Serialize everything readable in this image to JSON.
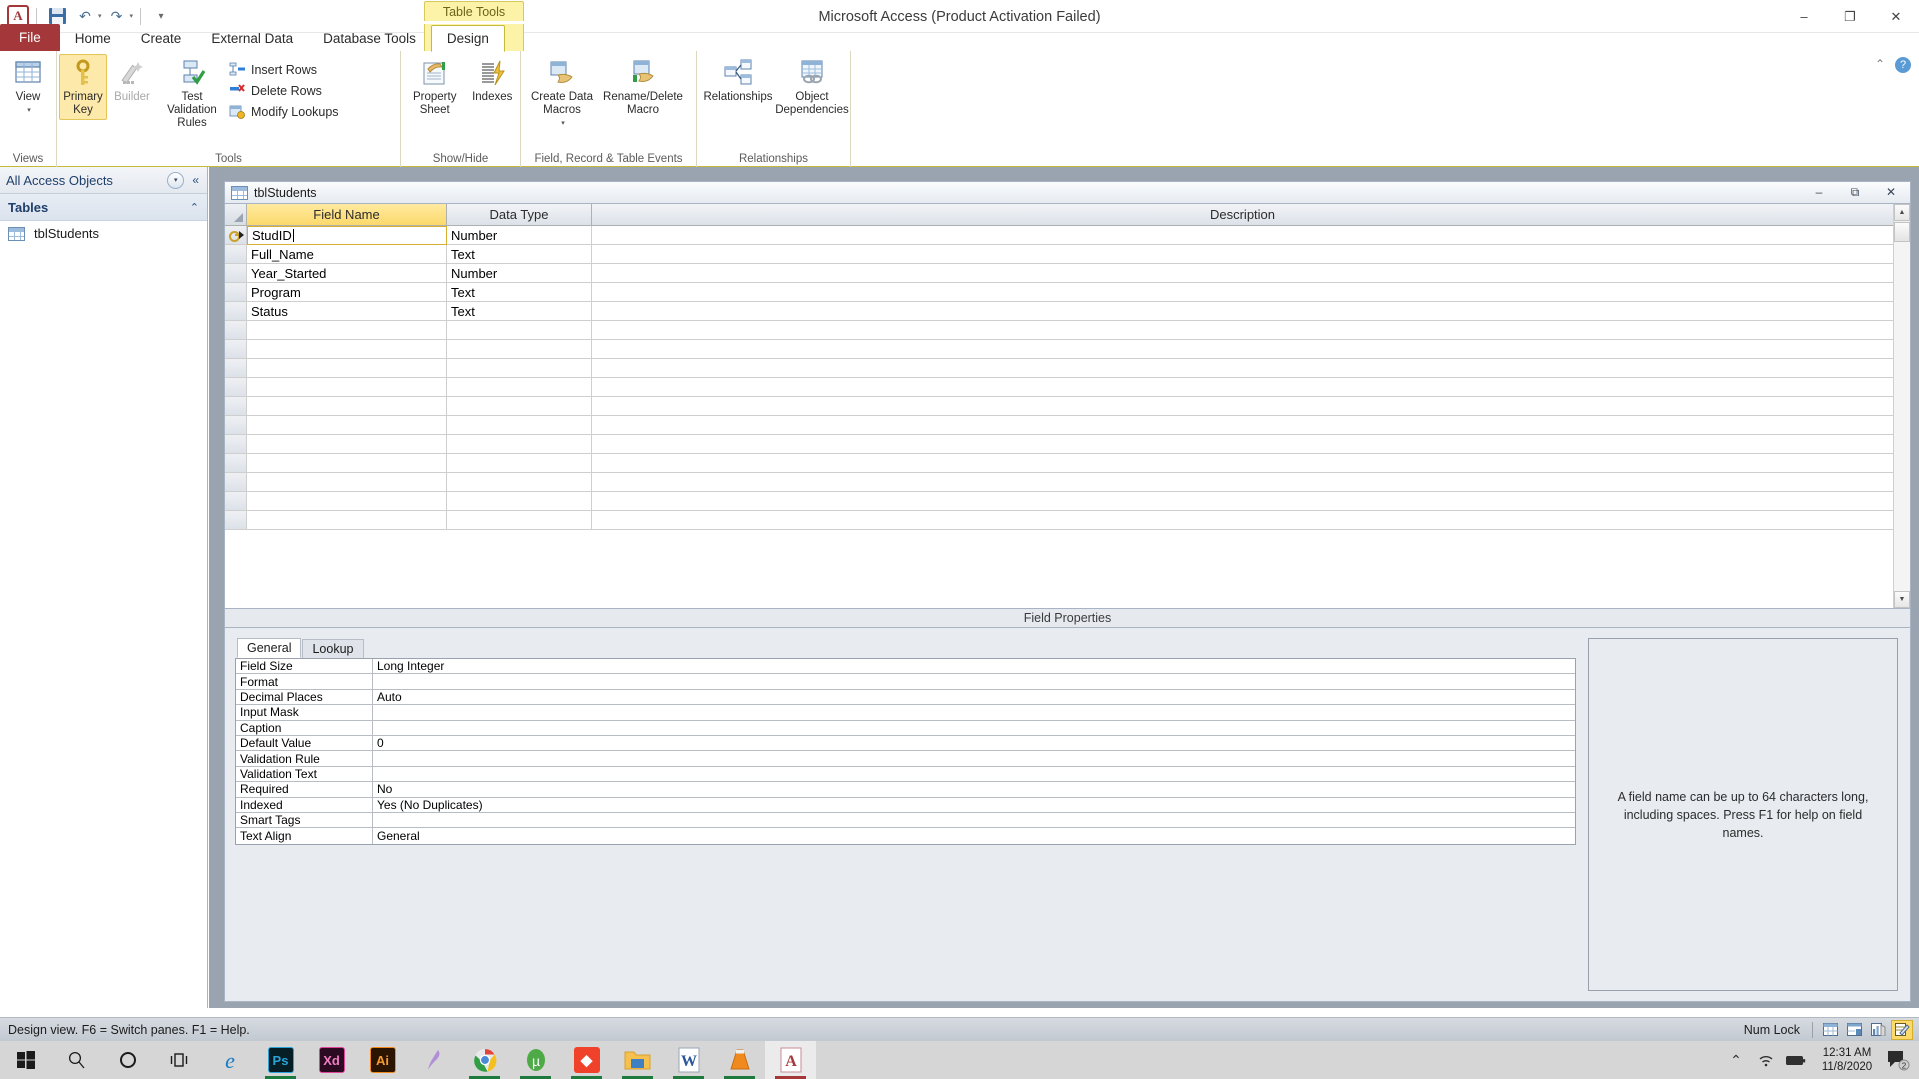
{
  "window": {
    "title": "Microsoft Access (Product Activation Failed)",
    "minimize": "–",
    "maximize": "❐",
    "close": "✕"
  },
  "quick_access": {
    "app_letter": "A",
    "save": "save-icon",
    "undo": "↶",
    "redo": "↷",
    "customize": "▾"
  },
  "ribbon": {
    "contextual_tab": "Table Tools",
    "tabs": [
      {
        "label": "File",
        "active": false
      },
      {
        "label": "Home",
        "active": false
      },
      {
        "label": "Create",
        "active": false
      },
      {
        "label": "External Data",
        "active": false
      },
      {
        "label": "Database Tools",
        "active": false
      },
      {
        "label": "Design",
        "active": true
      }
    ],
    "help_icons": {
      "minimize_ribbon": "⌃",
      "help": "?"
    },
    "groups": [
      {
        "label": "Views",
        "buttons": [
          {
            "label": "View",
            "caret": "▾",
            "state": "normal"
          }
        ]
      },
      {
        "label": "Tools",
        "buttons": [
          {
            "label": "Primary Key",
            "state": "selected"
          },
          {
            "label": "Builder",
            "state": "disabled"
          },
          {
            "label": "Test Validation Rules",
            "state": "normal"
          }
        ],
        "small_buttons": [
          {
            "label": "Insert Rows"
          },
          {
            "label": "Delete Rows"
          },
          {
            "label": "Modify Lookups"
          }
        ]
      },
      {
        "label": "Show/Hide",
        "buttons": [
          {
            "label": "Property Sheet",
            "state": "normal"
          },
          {
            "label": "Indexes",
            "state": "normal"
          }
        ]
      },
      {
        "label": "Field, Record & Table Events",
        "buttons": [
          {
            "label": "Create Data Macros",
            "caret": "▾",
            "state": "normal"
          },
          {
            "label": "Rename/Delete Macro",
            "state": "normal"
          }
        ]
      },
      {
        "label": "Relationships",
        "buttons": [
          {
            "label": "Relationships",
            "state": "normal"
          },
          {
            "label": "Object Dependencies",
            "state": "normal"
          }
        ]
      }
    ]
  },
  "navpane": {
    "title": "All Access Objects",
    "dropdown_icon": "▾",
    "collapse_icon": "«",
    "group_label": "Tables",
    "group_chevron": "⌃",
    "items": [
      {
        "label": "tblStudents",
        "icon": "table-icon"
      }
    ]
  },
  "document": {
    "tab_label": "tblStudents",
    "controls": {
      "minimize": "–",
      "restore": "⧉",
      "close": "✕"
    },
    "grid": {
      "headers": {
        "field_name": "Field Name",
        "data_type": "Data Type",
        "description": "Description"
      },
      "rows": [
        {
          "field_name": "StudID",
          "data_type": "Number",
          "description": "",
          "primary_key": true,
          "active": true
        },
        {
          "field_name": "Full_Name",
          "data_type": "Text",
          "description": "",
          "primary_key": false,
          "active": false
        },
        {
          "field_name": "Year_Started",
          "data_type": "Number",
          "description": "",
          "primary_key": false,
          "active": false
        },
        {
          "field_name": "Program",
          "data_type": "Text",
          "description": "",
          "primary_key": false,
          "active": false
        },
        {
          "field_name": "Status",
          "data_type": "Text",
          "description": "",
          "primary_key": false,
          "active": false
        }
      ],
      "empty_row_count": 11
    },
    "field_properties": {
      "section_title": "Field Properties",
      "tabs": [
        {
          "label": "General",
          "active": true
        },
        {
          "label": "Lookup",
          "active": false
        }
      ],
      "properties": [
        {
          "name": "Field Size",
          "value": "Long Integer"
        },
        {
          "name": "Format",
          "value": ""
        },
        {
          "name": "Decimal Places",
          "value": "Auto"
        },
        {
          "name": "Input Mask",
          "value": ""
        },
        {
          "name": "Caption",
          "value": ""
        },
        {
          "name": "Default Value",
          "value": "0"
        },
        {
          "name": "Validation Rule",
          "value": ""
        },
        {
          "name": "Validation Text",
          "value": ""
        },
        {
          "name": "Required",
          "value": "No"
        },
        {
          "name": "Indexed",
          "value": "Yes (No Duplicates)"
        },
        {
          "name": "Smart Tags",
          "value": ""
        },
        {
          "name": "Text Align",
          "value": "General"
        }
      ],
      "help_text": "A field name can be up to 64 characters long, including spaces. Press F1 for help on field names."
    }
  },
  "statusbar": {
    "message": "Design view.  F6 = Switch panes.  F1 = Help.",
    "num_lock": "Num Lock",
    "view_buttons": [
      {
        "name": "datasheet-view",
        "active": false
      },
      {
        "name": "pivottable-view",
        "active": false
      },
      {
        "name": "pivotchart-view",
        "active": false
      },
      {
        "name": "design-view",
        "active": true
      }
    ]
  },
  "taskbar": {
    "items": [
      {
        "name": "start",
        "label": "⊞",
        "running": false,
        "current": false
      },
      {
        "name": "search",
        "label": "⌕",
        "running": false,
        "current": false
      },
      {
        "name": "cortana",
        "label": "◯",
        "running": false,
        "current": false
      },
      {
        "name": "task-view",
        "label": "☰",
        "running": false,
        "current": false
      },
      {
        "name": "internet-explorer",
        "label": "e",
        "running": false,
        "current": false
      },
      {
        "name": "photoshop",
        "label": "Ps",
        "running": true,
        "current": false
      },
      {
        "name": "adobe-xd",
        "label": "Xd",
        "running": false,
        "current": false
      },
      {
        "name": "illustrator",
        "label": "Ai",
        "running": false,
        "current": false
      },
      {
        "name": "sublime-text",
        "label": "✎",
        "running": false,
        "current": false
      },
      {
        "name": "google-chrome",
        "label": "",
        "running": true,
        "current": false
      },
      {
        "name": "utorrent",
        "label": "µ",
        "running": true,
        "current": false
      },
      {
        "name": "vegas-pro",
        "label": "◆",
        "running": true,
        "current": false
      },
      {
        "name": "file-explorer",
        "label": "",
        "running": true,
        "current": false
      },
      {
        "name": "microsoft-word",
        "label": "W",
        "running": true,
        "current": false
      },
      {
        "name": "vlc-media-player",
        "label": "",
        "running": true,
        "current": false
      },
      {
        "name": "microsoft-access",
        "label": "A",
        "running": true,
        "current": true
      }
    ],
    "tray": {
      "show_hidden": "⌃",
      "network": "network-icon",
      "battery": "battery-icon",
      "time": "12:31 AM",
      "date": "11/8/2020",
      "notification_count": "2"
    }
  },
  "colors": {
    "accent": "#a4373a",
    "contextual_tab": "#fdf3a8",
    "selected_header": "#fcd96b",
    "grid_header": "#dde2e9"
  }
}
